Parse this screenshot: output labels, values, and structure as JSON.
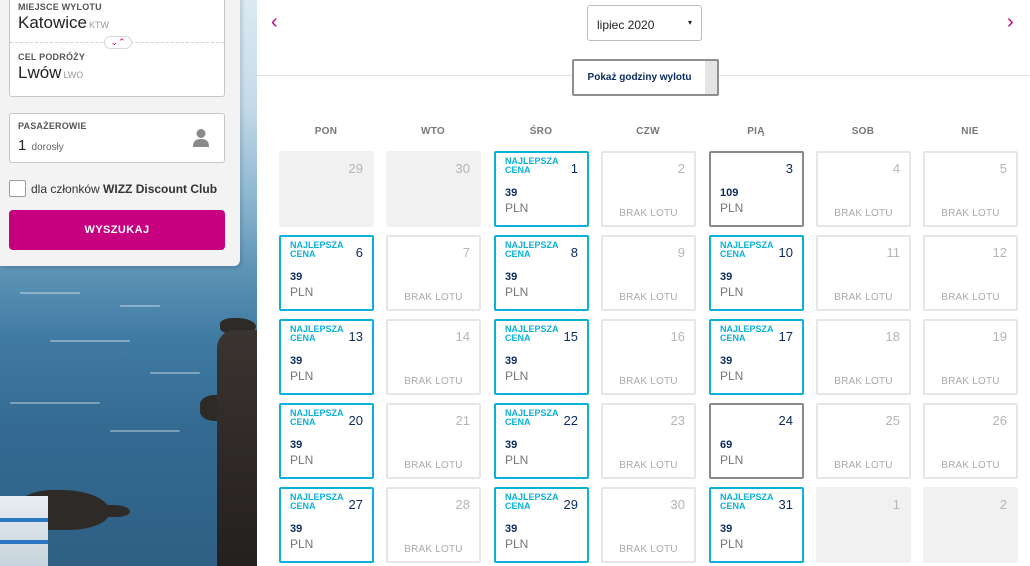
{
  "search": {
    "origin_label": "MIEJSCE WYLOTU",
    "origin_city": "Katowice",
    "origin_code": "KTW",
    "dest_label": "CEL PODRÓŻY",
    "dest_city": "Lwów",
    "dest_code": "LWO",
    "swap_glyph": "⌄⌃",
    "pax_label": "PASAŻEROWIE",
    "pax_count": "1",
    "pax_type": "dorosły",
    "club_prefix": "dla członków ",
    "club_name": "WIZZ Discount Club",
    "search_button": "WYSZUKAJ"
  },
  "calendar": {
    "month": "lipiec 2020",
    "caret": "▾",
    "prev": "‹",
    "next": "›",
    "hours_button": "Pokaż godziny wylotu",
    "weekdays": [
      "PON",
      "WTO",
      "ŚRO",
      "CZW",
      "PIĄ",
      "SOB",
      "NIE"
    ],
    "best_label": "NAJLEPSZA CENA",
    "no_flight_label": "BRAK LOTU",
    "currency": "PLN",
    "weeks": [
      [
        {
          "day": "29",
          "state": "blank"
        },
        {
          "day": "30",
          "state": "blank"
        },
        {
          "day": "1",
          "state": "best",
          "price": "39"
        },
        {
          "day": "2",
          "state": "none"
        },
        {
          "day": "3",
          "state": "avail",
          "price": "109"
        },
        {
          "day": "4",
          "state": "none"
        },
        {
          "day": "5",
          "state": "none"
        }
      ],
      [
        {
          "day": "6",
          "state": "best",
          "price": "39"
        },
        {
          "day": "7",
          "state": "none"
        },
        {
          "day": "8",
          "state": "best",
          "price": "39"
        },
        {
          "day": "9",
          "state": "none"
        },
        {
          "day": "10",
          "state": "best",
          "price": "39"
        },
        {
          "day": "11",
          "state": "none"
        },
        {
          "day": "12",
          "state": "none"
        }
      ],
      [
        {
          "day": "13",
          "state": "best",
          "price": "39"
        },
        {
          "day": "14",
          "state": "none"
        },
        {
          "day": "15",
          "state": "best",
          "price": "39"
        },
        {
          "day": "16",
          "state": "none"
        },
        {
          "day": "17",
          "state": "best",
          "price": "39"
        },
        {
          "day": "18",
          "state": "none"
        },
        {
          "day": "19",
          "state": "none"
        }
      ],
      [
        {
          "day": "20",
          "state": "best",
          "price": "39"
        },
        {
          "day": "21",
          "state": "none"
        },
        {
          "day": "22",
          "state": "best",
          "price": "39"
        },
        {
          "day": "23",
          "state": "none"
        },
        {
          "day": "24",
          "state": "avail",
          "price": "69"
        },
        {
          "day": "25",
          "state": "none"
        },
        {
          "day": "26",
          "state": "none"
        }
      ],
      [
        {
          "day": "27",
          "state": "best",
          "price": "39"
        },
        {
          "day": "28",
          "state": "none"
        },
        {
          "day": "29",
          "state": "best",
          "price": "39"
        },
        {
          "day": "30",
          "state": "none"
        },
        {
          "day": "31",
          "state": "best",
          "price": "39"
        },
        {
          "day": "1",
          "state": "blank"
        },
        {
          "day": "2",
          "state": "blank"
        }
      ]
    ]
  },
  "colors": {
    "brand": "#c6007e",
    "best_price": "#0bb1d6",
    "navy": "#0a2a5e"
  }
}
